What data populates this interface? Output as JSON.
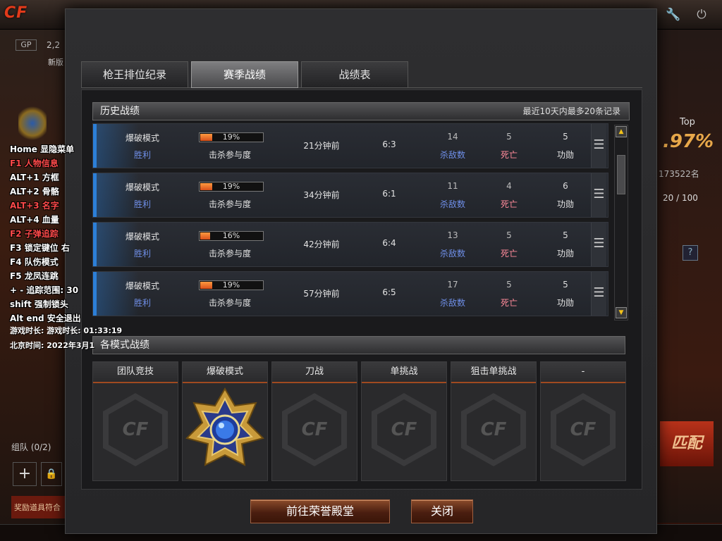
{
  "background": {
    "logo_text": "CF",
    "gp_label": "GP",
    "gp_value": "2,2",
    "new_label": "新版",
    "group_label": "组队 (0/2)",
    "left_strip_text": "奖励道具符合",
    "top_label": "Top",
    "top_percent": ".97%",
    "rank_text": "173522名",
    "score_text": "20 / 100",
    "match_label": "匹配"
  },
  "overlay": {
    "lines": [
      {
        "text": "Home 显隐菜单",
        "color": "white"
      },
      {
        "text": "F1 人物信息",
        "color": "red"
      },
      {
        "text": "ALT+1 方框",
        "color": "white"
      },
      {
        "text": "ALT+2 骨骼",
        "color": "white"
      },
      {
        "text": "ALT+3 名字",
        "color": "red"
      },
      {
        "text": "ALT+4 血量",
        "color": "white"
      },
      {
        "text": "F2 子弹追踪",
        "color": "red"
      },
      {
        "text": "F3 锁定键位 右",
        "color": "white"
      },
      {
        "text": "F4 队伤模式",
        "color": "white"
      },
      {
        "text": "F5 龙凤连跳",
        "color": "white"
      },
      {
        "text": "+ - 追踪范围: 30",
        "color": "white"
      },
      {
        "text": "shift 强制锁头",
        "color": "white"
      },
      {
        "text": "Alt end 安全退出",
        "color": "white"
      }
    ],
    "game_time": "游戏时长:  游戏时长:  01:33:19",
    "beijing_time": "北京时间:  2022年3月1"
  },
  "dialog": {
    "tabs": [
      {
        "label": "枪王排位纪录",
        "active": false
      },
      {
        "label": "赛季战绩",
        "active": true
      },
      {
        "label": "战绩表",
        "active": false
      }
    ],
    "history": {
      "title": "历史战绩",
      "note": "最近10天内最多20条记录",
      "rows": [
        {
          "mode": "爆破模式",
          "result": "胜利",
          "percent": "19%",
          "percent_value": 19,
          "contrib_label": "击杀参与度",
          "time": "21分钟前",
          "score": "6:3",
          "kills": "14",
          "kills_label": "杀敌数",
          "deaths": "5",
          "deaths_label": "死亡",
          "assists": "5",
          "assists_label": "功勋"
        },
        {
          "mode": "爆破模式",
          "result": "胜利",
          "percent": "19%",
          "percent_value": 19,
          "contrib_label": "击杀参与度",
          "time": "34分钟前",
          "score": "6:1",
          "kills": "11",
          "kills_label": "杀敌数",
          "deaths": "4",
          "deaths_label": "死亡",
          "assists": "6",
          "assists_label": "功勋"
        },
        {
          "mode": "爆破模式",
          "result": "胜利",
          "percent": "16%",
          "percent_value": 16,
          "contrib_label": "击杀参与度",
          "time": "42分钟前",
          "score": "6:4",
          "kills": "13",
          "kills_label": "杀敌数",
          "deaths": "5",
          "deaths_label": "死亡",
          "assists": "5",
          "assists_label": "功勋"
        },
        {
          "mode": "爆破模式",
          "result": "胜利",
          "percent": "19%",
          "percent_value": 19,
          "contrib_label": "击杀参与度",
          "time": "57分钟前",
          "score": "6:5",
          "kills": "17",
          "kills_label": "杀敌数",
          "deaths": "5",
          "deaths_label": "死亡",
          "assists": "5",
          "assists_label": "功勋"
        }
      ]
    },
    "modes_section": {
      "title": "各模式战绩",
      "modes": [
        {
          "label": "团队竞技",
          "has_badge": false
        },
        {
          "label": "爆破模式",
          "has_badge": true
        },
        {
          "label": "刀战",
          "has_badge": false
        },
        {
          "label": "单挑战",
          "has_badge": false
        },
        {
          "label": "狙击单挑战",
          "has_badge": false
        },
        {
          "label": "-",
          "has_badge": false
        }
      ]
    },
    "buttons": {
      "hall_of_honor": "前往荣誉殿堂",
      "close": "关闭"
    }
  },
  "colors": {
    "accent_blue": "#2c7fd8",
    "victory_blue": "#6f8fe8",
    "death_pink": "#ff8a9a",
    "progress_orange": "#e8701e",
    "scroll_arrow_yellow": "#f2c21a",
    "overlay_red": "#ff4a4a"
  }
}
